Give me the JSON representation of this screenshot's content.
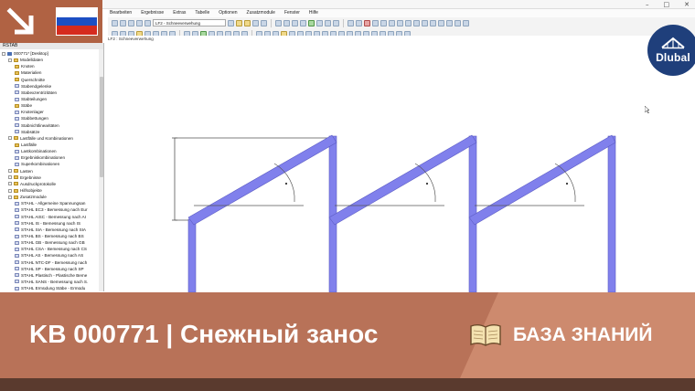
{
  "window": {
    "controls": [
      "–",
      "□",
      "✕"
    ]
  },
  "menu": [
    "Bearbeiten",
    "Ergebnisse",
    "Extras",
    "Tabelle",
    "Optionen",
    "Zusatzmodule",
    "Fenster",
    "Hilfe"
  ],
  "toolbar": {
    "loadcase_combo": "LF2 - Schneeverwehung"
  },
  "workarea": {
    "label": "LF2 : Schneeverwehung"
  },
  "navigator": {
    "title": "RSTAB",
    "items": [
      {
        "level": 0,
        "label": "000771* [Desktop]",
        "icon": "project-icon"
      },
      {
        "level": 1,
        "label": "Modelldaten",
        "icon": "folder-icon"
      },
      {
        "level": 2,
        "label": "Knoten",
        "icon": "folder-icon"
      },
      {
        "level": 2,
        "label": "Materialien",
        "icon": "folder-icon"
      },
      {
        "level": 2,
        "label": "Querschnitte",
        "icon": "folder-icon"
      },
      {
        "level": 2,
        "label": "Stabendgelenke",
        "icon": "node-icon"
      },
      {
        "level": 2,
        "label": "Stabexzentrizitäten",
        "icon": "node-icon"
      },
      {
        "level": 2,
        "label": "Stabteilungen",
        "icon": "node-icon"
      },
      {
        "level": 2,
        "label": "Stäbe",
        "icon": "folder-icon"
      },
      {
        "level": 2,
        "label": "Knotenlager",
        "icon": "node-icon"
      },
      {
        "level": 2,
        "label": "Stabbettungen",
        "icon": "node-icon"
      },
      {
        "level": 2,
        "label": "Stabnichtlinearitäten",
        "icon": "node-icon"
      },
      {
        "level": 2,
        "label": "Stabsätze",
        "icon": "node-icon"
      },
      {
        "level": 1,
        "label": "Lastfälle und Kombinationen",
        "icon": "folder-icon"
      },
      {
        "level": 2,
        "label": "Lastfälle",
        "icon": "folder-icon"
      },
      {
        "level": 2,
        "label": "Lastkombinationen",
        "icon": "node-icon"
      },
      {
        "level": 2,
        "label": "Ergebniskombinationen",
        "icon": "node-icon"
      },
      {
        "level": 2,
        "label": "Superkombinationen",
        "icon": "node-icon"
      },
      {
        "level": 1,
        "label": "Lasten",
        "icon": "folder-icon"
      },
      {
        "level": 1,
        "label": "Ergebnisse",
        "icon": "folder-icon"
      },
      {
        "level": 1,
        "label": "Ausdruckprotokolle",
        "icon": "folder-icon"
      },
      {
        "level": 1,
        "label": "Hilfsobjekte",
        "icon": "folder-icon"
      },
      {
        "level": 1,
        "label": "Zusatzmodule",
        "icon": "folder-icon"
      },
      {
        "level": 2,
        "label": "STAHL - Allgemeine Spannungsan",
        "icon": "node-icon"
      },
      {
        "level": 2,
        "label": "STAHL EC3 - Bemessung nach Eur",
        "icon": "node-icon"
      },
      {
        "level": 2,
        "label": "STAHL AISC - Bemessung nach AI",
        "icon": "node-icon"
      },
      {
        "level": 2,
        "label": "STAHL IS - Bemessung nach IS",
        "icon": "node-icon"
      },
      {
        "level": 2,
        "label": "STAHL SIA - Bemessung nach SIA",
        "icon": "node-icon"
      },
      {
        "level": 2,
        "label": "STAHL BS - Bemessung nach BS",
        "icon": "node-icon"
      },
      {
        "level": 2,
        "label": "STAHL GB - Bemessung nach GB",
        "icon": "node-icon"
      },
      {
        "level": 2,
        "label": "STAHL CSA - Bemessung nach CS",
        "icon": "node-icon"
      },
      {
        "level": 2,
        "label": "STAHL AS - Bemessung nach AS",
        "icon": "node-icon"
      },
      {
        "level": 2,
        "label": "STAHL NTC-DF - Bemessung nach",
        "icon": "node-icon"
      },
      {
        "level": 2,
        "label": "STAHL SP - Bemessung nach SP",
        "icon": "node-icon"
      },
      {
        "level": 2,
        "label": "STAHL Plastisch - Plastische Beme",
        "icon": "node-icon"
      },
      {
        "level": 2,
        "label": "STAHL SANS - Bemessung nach S.",
        "icon": "node-icon"
      },
      {
        "level": 2,
        "label": "STAHL Ermüdung Stäbe - Ermüdu",
        "icon": "node-icon"
      }
    ]
  },
  "badge": {
    "arrow_icon": "arrow-down-right-icon",
    "flag": "russia-flag-icon",
    "flag_colors": [
      "#ffffff",
      "#1c4fc4",
      "#d52b1e"
    ]
  },
  "logo": {
    "text": "Dlubal",
    "color": "#1f3f7b"
  },
  "banner": {
    "title": "KB 000771 | Снежный занос",
    "kb_label": "БАЗА ЗНАНИЙ",
    "book_icon": "open-book-icon",
    "bg_color": "#b87258",
    "panel_color": "#cd8a6e"
  },
  "model": {
    "member_color": "#8080ec",
    "dimension_color": "#555555"
  }
}
